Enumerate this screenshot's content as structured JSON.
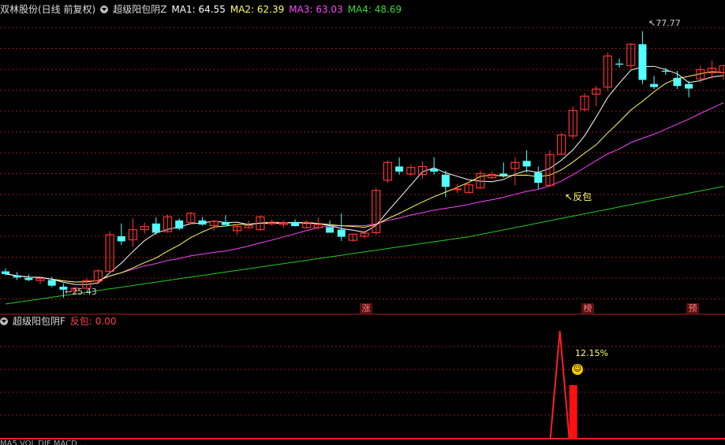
{
  "main_header": {
    "stock": "双林股份(日线 前复权)",
    "indicator": "超级阳包阴Z",
    "ma1": "MA1: 64.55",
    "ma2": "MA2: 62.39",
    "ma3": "MA3: 63.03",
    "ma4": "MA4: 48.69"
  },
  "sub_header": {
    "indicator": "超级阳包阴F",
    "value": "反包: 0.00"
  },
  "annotations": {
    "high": "77.77",
    "low": "25.43",
    "fanbao": "反包",
    "pct": "12.15%",
    "tag1": "涨",
    "tag2": "榜",
    "tag3": "预"
  },
  "footer": "MA5 VOL DIF MACD ...",
  "colors": {
    "up": "#ff3232",
    "down": "#54ffff",
    "ma1": "#ffffff",
    "ma2": "#ffff66",
    "ma3": "#ff44ff",
    "ma4": "#22cc22",
    "grid": "#8a1a1a"
  },
  "chart_data": {
    "type": "candlestick",
    "ylim": [
      25,
      80
    ],
    "candles": [
      {
        "o": 30.6,
        "h": 31.2,
        "l": 29.8,
        "c": 30.1
      },
      {
        "o": 29.8,
        "h": 30.5,
        "l": 28.9,
        "c": 29.4
      },
      {
        "o": 29.3,
        "h": 30.0,
        "l": 28.7,
        "c": 28.9
      },
      {
        "o": 28.8,
        "h": 29.6,
        "l": 28.1,
        "c": 29.2
      },
      {
        "o": 28.9,
        "h": 29.5,
        "l": 27.5,
        "c": 27.8
      },
      {
        "o": 27.6,
        "h": 28.2,
        "l": 25.43,
        "c": 27.0
      },
      {
        "o": 26.8,
        "h": 27.6,
        "l": 26.0,
        "c": 27.3
      },
      {
        "o": 27.3,
        "h": 29.2,
        "l": 27.0,
        "c": 28.8
      },
      {
        "o": 28.7,
        "h": 31.0,
        "l": 28.4,
        "c": 30.7
      },
      {
        "o": 30.6,
        "h": 38.5,
        "l": 30.2,
        "c": 37.8
      },
      {
        "o": 37.5,
        "h": 40.0,
        "l": 35.8,
        "c": 36.5
      },
      {
        "o": 36.8,
        "h": 41.0,
        "l": 35.4,
        "c": 38.8
      },
      {
        "o": 38.8,
        "h": 40.2,
        "l": 38.0,
        "c": 39.4
      },
      {
        "o": 40.0,
        "h": 41.2,
        "l": 37.8,
        "c": 38.2
      },
      {
        "o": 38.4,
        "h": 41.8,
        "l": 38.2,
        "c": 41.3
      },
      {
        "o": 40.6,
        "h": 41.0,
        "l": 38.7,
        "c": 39.0
      },
      {
        "o": 40.2,
        "h": 42.3,
        "l": 39.8,
        "c": 42.0
      },
      {
        "o": 40.6,
        "h": 41.3,
        "l": 39.6,
        "c": 39.8
      },
      {
        "o": 39.6,
        "h": 40.6,
        "l": 38.6,
        "c": 40.4
      },
      {
        "o": 40.3,
        "h": 41.6,
        "l": 39.8,
        "c": 39.7
      },
      {
        "o": 38.6,
        "h": 39.8,
        "l": 37.8,
        "c": 39.4
      },
      {
        "o": 39.2,
        "h": 40.6,
        "l": 39.0,
        "c": 39.6
      },
      {
        "o": 38.8,
        "h": 41.6,
        "l": 38.6,
        "c": 41.3
      },
      {
        "o": 40.0,
        "h": 40.8,
        "l": 39.6,
        "c": 40.1
      },
      {
        "o": 39.8,
        "h": 40.6,
        "l": 39.2,
        "c": 40.2
      },
      {
        "o": 40.3,
        "h": 40.8,
        "l": 39.4,
        "c": 39.5
      },
      {
        "o": 39.2,
        "h": 40.6,
        "l": 39.0,
        "c": 40.2
      },
      {
        "o": 39.2,
        "h": 41.2,
        "l": 38.8,
        "c": 39.8
      },
      {
        "o": 39.3,
        "h": 40.6,
        "l": 38.6,
        "c": 38.2
      },
      {
        "o": 38.8,
        "h": 42.0,
        "l": 36.6,
        "c": 37.4
      },
      {
        "o": 36.7,
        "h": 38.0,
        "l": 36.4,
        "c": 37.9
      },
      {
        "o": 37.5,
        "h": 38.6,
        "l": 37.0,
        "c": 38.1
      },
      {
        "o": 38.2,
        "h": 47.0,
        "l": 37.8,
        "c": 46.5
      },
      {
        "o": 48.5,
        "h": 52.4,
        "l": 48.0,
        "c": 52.0
      },
      {
        "o": 51.2,
        "h": 53.0,
        "l": 49.6,
        "c": 50.2
      },
      {
        "o": 49.7,
        "h": 51.6,
        "l": 49.4,
        "c": 51.0
      },
      {
        "o": 49.6,
        "h": 52.2,
        "l": 48.8,
        "c": 51.2
      },
      {
        "o": 50.7,
        "h": 53.0,
        "l": 49.6,
        "c": 50.2
      },
      {
        "o": 49.6,
        "h": 50.4,
        "l": 45.2,
        "c": 47.2
      },
      {
        "o": 46.8,
        "h": 47.8,
        "l": 46.0,
        "c": 46.8
      },
      {
        "o": 46.1,
        "h": 48.2,
        "l": 45.8,
        "c": 47.6
      },
      {
        "o": 47.0,
        "h": 50.4,
        "l": 46.8,
        "c": 49.8
      },
      {
        "o": 49.0,
        "h": 50.2,
        "l": 48.8,
        "c": 49.6
      },
      {
        "o": 49.8,
        "h": 52.0,
        "l": 49.0,
        "c": 49.4
      },
      {
        "o": 50.8,
        "h": 53.0,
        "l": 47.5,
        "c": 52.0
      },
      {
        "o": 52.3,
        "h": 54.4,
        "l": 50.0,
        "c": 51.2
      },
      {
        "o": 50.0,
        "h": 51.2,
        "l": 46.8,
        "c": 48.0
      },
      {
        "o": 47.5,
        "h": 54.4,
        "l": 47.2,
        "c": 53.5
      },
      {
        "o": 53.6,
        "h": 57.8,
        "l": 53.4,
        "c": 57.4
      },
      {
        "o": 57.2,
        "h": 63.0,
        "l": 56.6,
        "c": 62.2
      },
      {
        "o": 62.4,
        "h": 65.6,
        "l": 62.0,
        "c": 65.0
      },
      {
        "o": 65.4,
        "h": 67.0,
        "l": 63.0,
        "c": 66.4
      },
      {
        "o": 66.8,
        "h": 73.6,
        "l": 66.0,
        "c": 72.9
      },
      {
        "o": 71.4,
        "h": 72.4,
        "l": 70.6,
        "c": 71.2
      },
      {
        "o": 71.0,
        "h": 75.4,
        "l": 70.4,
        "c": 75.2
      },
      {
        "o": 75.2,
        "h": 77.77,
        "l": 67.4,
        "c": 68.2
      },
      {
        "o": 67.4,
        "h": 69.0,
        "l": 66.4,
        "c": 66.8
      },
      {
        "o": 70.0,
        "h": 70.6,
        "l": 69.2,
        "c": 69.8
      },
      {
        "o": 68.6,
        "h": 70.0,
        "l": 66.4,
        "c": 67.0
      },
      {
        "o": 67.4,
        "h": 68.0,
        "l": 64.8,
        "c": 66.5
      },
      {
        "o": 68.4,
        "h": 71.0,
        "l": 67.6,
        "c": 70.2
      },
      {
        "o": 69.6,
        "h": 72.0,
        "l": 68.4,
        "c": 70.5
      },
      {
        "o": 69.6,
        "h": 71.0,
        "l": 68.2,
        "c": 71.0
      }
    ],
    "sub": {
      "type": "line",
      "ylim": [
        0,
        16
      ],
      "peak_value": 12.15
    }
  }
}
